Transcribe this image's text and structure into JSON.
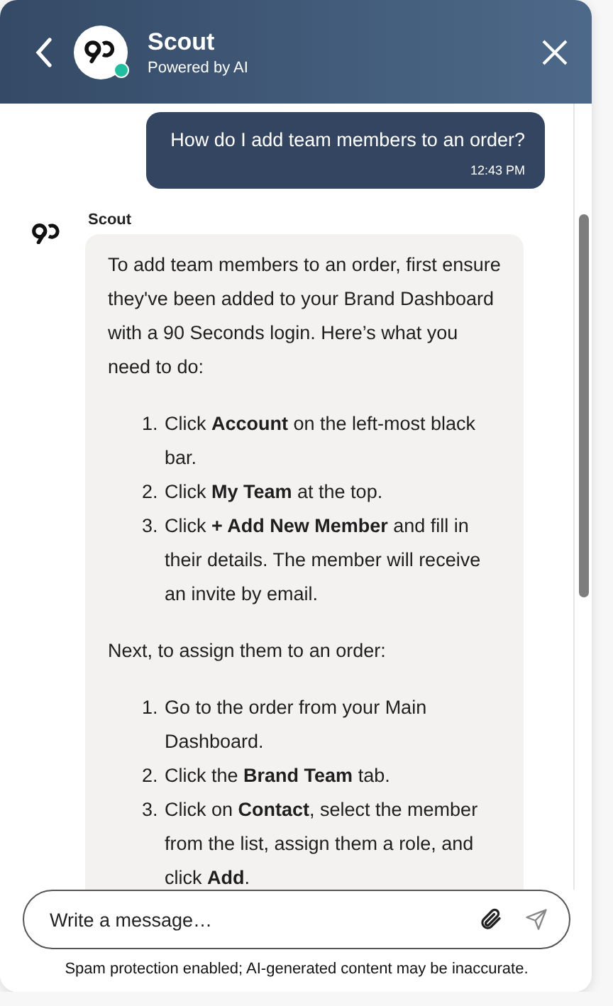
{
  "header": {
    "title": "Scout",
    "subtitle": "Powered by AI",
    "online": true
  },
  "messages": [
    {
      "kind": "user",
      "text": "How do I add team members to an order?",
      "time": "12:43 PM"
    },
    {
      "kind": "bot",
      "sender": "Scout",
      "blocks": [
        {
          "kind": "paragraph",
          "text": "To add team members to an order, first ensure they've been added to your Brand Dashboard with a 90 Seconds login. Here’s what you need to do:"
        },
        {
          "kind": "list",
          "items": [
            {
              "marker": "1.",
              "text": "Click **Account** on the left-most black bar."
            },
            {
              "marker": "2.",
              "text": "Click **My Team** at the top."
            },
            {
              "marker": "3.",
              "text": "Click **+ Add New Member** and fill in their details. The member will receive an invite by email."
            }
          ]
        },
        {
          "kind": "paragraph",
          "text": "Next, to assign them to an order:"
        },
        {
          "kind": "list",
          "items": [
            {
              "marker": "1.",
              "text": "Go to the order from your Main Dashboard."
            },
            {
              "marker": "2.",
              "text": "Click the **Brand Team** tab."
            },
            {
              "marker": "3.",
              "text": "Click on **Contact**, select the member from the list, assign them a role, and click **Add**."
            }
          ]
        }
      ]
    }
  ],
  "composer": {
    "placeholder": "Write a message…"
  },
  "footer": "Spam protection enabled; AI-generated content may be inaccurate."
}
